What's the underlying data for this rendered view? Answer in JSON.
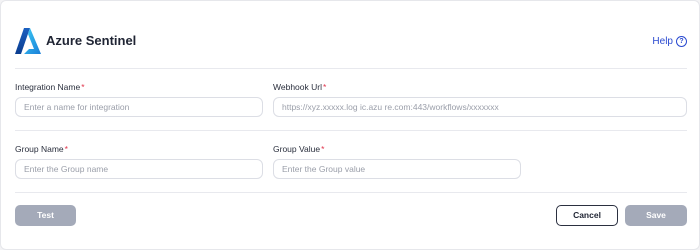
{
  "header": {
    "title": "Azure Sentinel",
    "help_label": "Help",
    "help_icon": "question-circle-icon",
    "logo_icon": "azure-logo-icon"
  },
  "form": {
    "integration_name": {
      "label": "Integration Name",
      "required_mark": "*",
      "placeholder": "Enter a name for integration",
      "value": ""
    },
    "webhook_url": {
      "label": "Webhook Url",
      "required_mark": "*",
      "placeholder": "https://xyz.xxxxx.log ic.azu re.com:443/workflows/xxxxxxx",
      "value": ""
    },
    "group_name": {
      "label": "Group Name",
      "required_mark": "*",
      "placeholder": "Enter the Group name",
      "value": ""
    },
    "group_value": {
      "label": "Group Value",
      "required_mark": "*",
      "placeholder": "Enter the Group value",
      "value": ""
    }
  },
  "actions": {
    "test_label": "Test",
    "cancel_label": "Cancel",
    "save_label": "Save"
  },
  "colors": {
    "accent": "#2a4ad0",
    "required": "#e0344b",
    "disabled_button": "#a4aab9"
  }
}
